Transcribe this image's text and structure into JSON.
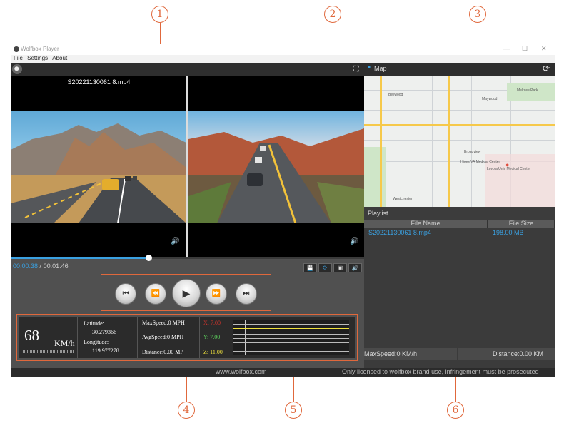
{
  "callouts": [
    "1",
    "2",
    "3",
    "4",
    "5",
    "6"
  ],
  "window": {
    "title": "Wolfbox Player",
    "minimize": "—",
    "maximize": "☐",
    "close": "✕"
  },
  "menu": [
    "File",
    "Settings",
    "About"
  ],
  "player": {
    "filename": "S20221130061 8.mp4",
    "current_time": "00:00:38",
    "separator": " / ",
    "total_time": "00:01:46",
    "progress": 0.39,
    "volume_icon": "🔊",
    "fullscreen_icon": "⛶"
  },
  "mini_tools": [
    "💾",
    "⟳",
    "▣",
    "🔊"
  ],
  "controls": {
    "prev": "⏮",
    "rewind": "⏪",
    "play": "▶",
    "forward": "⏩",
    "next": "⏭"
  },
  "telemetry": {
    "speed": "68",
    "speed_unit": "KM/h",
    "lat_label": "Latitude:",
    "lat_value": "30.279366",
    "lon_label": "Longitude:",
    "lon_value": "119.977278",
    "max_speed": "MaxSpeed:0 MPH",
    "avg_speed": "AvgSpeed:0 MPH",
    "distance": "Distance:0.00 MP",
    "x": "X: 7.00",
    "y": "Y: 7.00",
    "z": "Z: 11.00",
    "colors": {
      "x": "#d0342c",
      "y": "#5dd35d",
      "z": "#f0e23c"
    }
  },
  "footer": {
    "site": "www.wolfbox.com",
    "notice": "Only licensed to wolfbox brand use, infringement must be prosecuted"
  },
  "map": {
    "title": "Map",
    "refresh_icon": "⟳",
    "labels": [
      "Bellwood",
      "Maywood",
      "Broadview",
      "Westchester",
      "Loyola Univ Medical Center",
      "Hines VA Medical Center",
      "Melrose Park"
    ]
  },
  "playlist": {
    "title": "Playlist",
    "columns": [
      "File Name",
      "File Size"
    ],
    "rows": [
      {
        "name": "S20221130061 8.mp4",
        "size": "198.00 MB"
      }
    ],
    "max_speed": "MaxSpeed:0 KM/h",
    "distance": "Distance:0.00 KM"
  }
}
